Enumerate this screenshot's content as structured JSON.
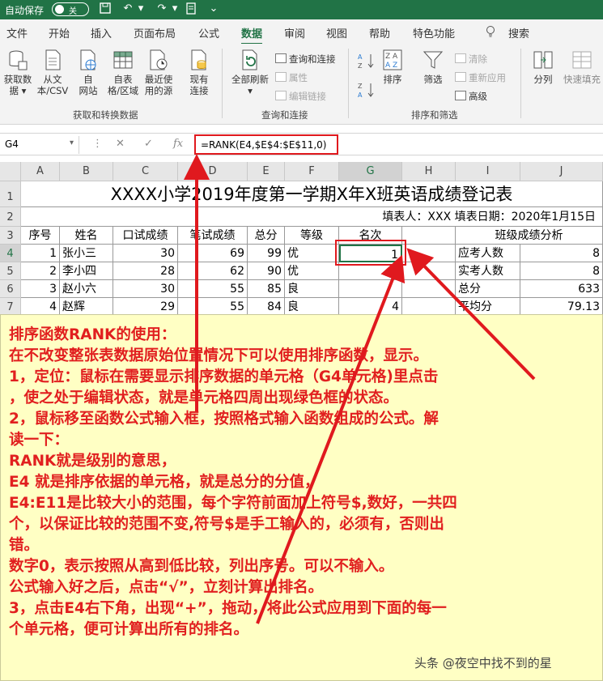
{
  "titlebar": {
    "autosave_label": "自动保存",
    "autosave_state": "关"
  },
  "tabs": [
    "文件",
    "开始",
    "插入",
    "页面布局",
    "公式",
    "数据",
    "审阅",
    "视图",
    "帮助",
    "特色功能",
    "告诉我",
    "搜索"
  ],
  "active_tab": "数据",
  "ribbon": {
    "get_data": [
      "获取数",
      "据 ▾"
    ],
    "from_text": [
      "从文",
      "本/CSV"
    ],
    "from_web": [
      "自",
      "网站"
    ],
    "from_table": [
      "自表",
      "格/区域"
    ],
    "recent_sources": [
      "最近使",
      "用的源"
    ],
    "existing_conn": [
      "现有",
      "连接"
    ],
    "group_get": "获取和转换数据",
    "refresh_all": [
      "全部刷新",
      "▾"
    ],
    "queries_conn": "查询和连接",
    "properties": "属性",
    "edit_links": "编辑链接",
    "group_queries": "查询和连接",
    "sort_label": "排序",
    "filter_label": "筛选",
    "clear": "清除",
    "reapply": "重新应用",
    "advanced": "高级",
    "group_sort": "排序和筛选",
    "split": "分列",
    "flash_fill": "快速填充"
  },
  "formula_bar": {
    "name_box": "G4",
    "formula": "=RANK(E4,$E$4:$E$11,0)",
    "fx": "fx"
  },
  "columns": [
    "A",
    "B",
    "C",
    "D",
    "E",
    "F",
    "G",
    "H",
    "I",
    "J"
  ],
  "rows": [
    "1",
    "2",
    "3",
    "4",
    "5",
    "6",
    "7"
  ],
  "sheet": {
    "title": "XXXX小学2019年度第一学期X年X班英语成绩登记表",
    "filler": "填表人：XXX   填表日期：2020年1月15日",
    "headers": [
      "序号",
      "姓名",
      "口试成绩",
      "笔试成绩",
      "总分",
      "等级",
      "名次",
      "",
      "班级成绩分析"
    ],
    "records": [
      {
        "no": "1",
        "name": "张小三",
        "oral": "30",
        "written": "69",
        "total": "99",
        "grade": "优",
        "rank": "1",
        "stat": "应考人数",
        "stat_val": "8"
      },
      {
        "no": "2",
        "name": "李小四",
        "oral": "28",
        "written": "62",
        "total": "90",
        "grade": "优",
        "rank": "",
        "stat": "实考人数",
        "stat_val": "8"
      },
      {
        "no": "3",
        "name": "赵小六",
        "oral": "30",
        "written": "55",
        "total": "85",
        "grade": "良",
        "rank": "",
        "stat": "总分",
        "stat_val": "633"
      },
      {
        "no": "4",
        "name": "赵辉",
        "oral": "29",
        "written": "55",
        "total": "84",
        "grade": "良",
        "rank": "4",
        "stat": "平均分",
        "stat_val": "79.13"
      }
    ]
  },
  "annotation": {
    "lines": [
      "排序函数RANK的使用：",
      "在不改变整张表数据原始位置情况下可以使用排序函数，显示。",
      "1，定位：鼠标在需要显示排序数据的单元格（G4单元格)里点击",
      "，使之处于编辑状态，就是单元格四周出现绿色框的状态。",
      "2，鼠标移至函数公式输入框，按照格式输入函数组成的公式。解",
      "读一下：",
      "RANK就是级别的意思，",
      "E4 就是排序依据的单元格，就是总分的分值，",
      "E4:E11是比较大小的范围，每个字符前面加上符号$,数好，一共四",
      "个，以保证比较的范围不变,符号$是手工输入的，必须有，否则出",
      "错。",
      "数字0，表示按照从高到低比较，列出序号。可以不输入。",
      "公式输入好之后，点击“√”，立刻计算出排名。",
      "3，点击E4右下角，出现“+”，拖动，将此公式应用到下面的每一",
      "个单元格，便可计算出所有的排名。"
    ],
    "watermark": "头条 @夜空中找不到的星"
  },
  "colors": {
    "excel_green": "#217346",
    "annotation_red": "#e11f1f",
    "note_bg": "#ffffc4"
  }
}
